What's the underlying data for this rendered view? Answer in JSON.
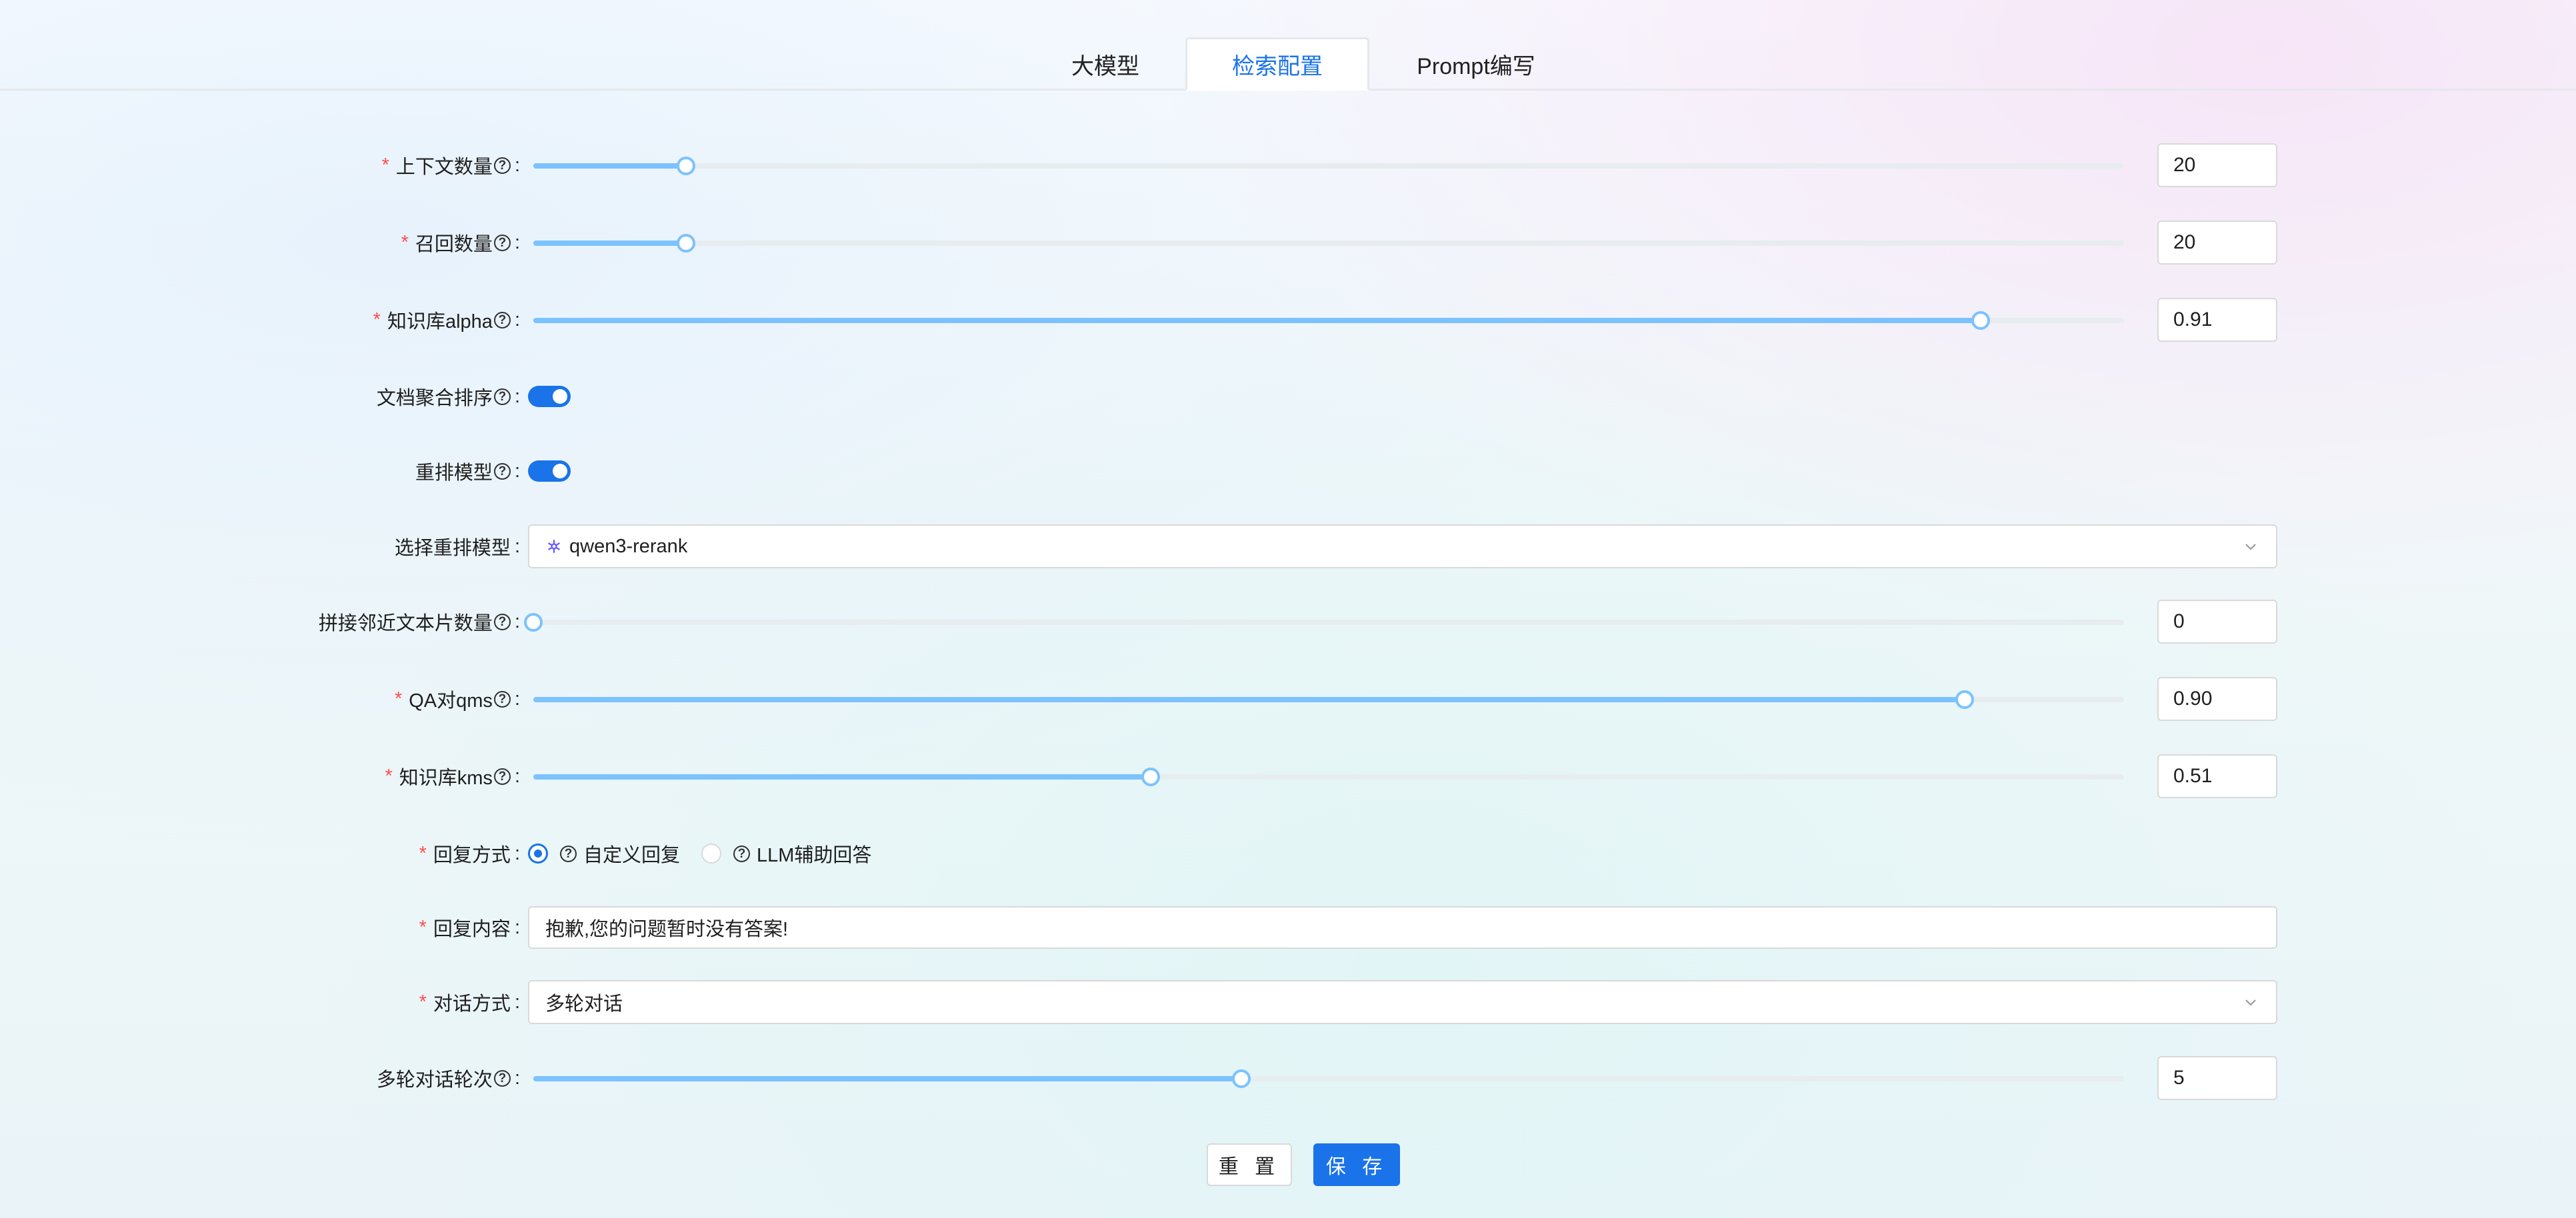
{
  "tabs": [
    {
      "label": "大模型",
      "active": false
    },
    {
      "label": "检索配置",
      "active": true
    },
    {
      "label": "Prompt编写",
      "active": false
    }
  ],
  "colors": {
    "accent": "#1a73e8",
    "slider": "#7cc2ff",
    "required": "#ff4d4f"
  },
  "form": {
    "context_count": {
      "label": "上下文数量",
      "value": "20",
      "level": 0.096
    },
    "recall_count": {
      "label": "召回数量",
      "value": "20",
      "level": 0.096
    },
    "kb_alpha": {
      "label": "知识库alpha",
      "value": "0.91",
      "level": 0.91
    },
    "doc_merge_sort": {
      "label": "文档聚合排序",
      "on": true
    },
    "rerank_model": {
      "label": "重排模型",
      "on": true
    },
    "select_rerank": {
      "label": "选择重排模型",
      "value": "qwen3-rerank",
      "icon": "model-icon"
    },
    "adjacent_chunks": {
      "label": "拼接邻近文本片数量",
      "value": "0",
      "level": 0.0
    },
    "qa_qms": {
      "label": "QA对qms",
      "value": "0.90",
      "level": 0.9
    },
    "kb_kms": {
      "label": "知识库kms",
      "value": "0.51",
      "level": 0.388
    },
    "reply_mode": {
      "label": "回复方式",
      "options": [
        "自定义回复",
        "LLM辅助回答"
      ],
      "selected": "自定义回复"
    },
    "reply_content": {
      "label": "回复内容",
      "value": "抱歉,您的问题暂时没有答案!"
    },
    "dialog_mode": {
      "label": "对话方式",
      "value": "多轮对话"
    },
    "multi_turn_rounds": {
      "label": "多轮对话轮次",
      "value": "5",
      "level": 0.445
    }
  },
  "buttons": {
    "reset": "重 置",
    "save": "保 存"
  }
}
